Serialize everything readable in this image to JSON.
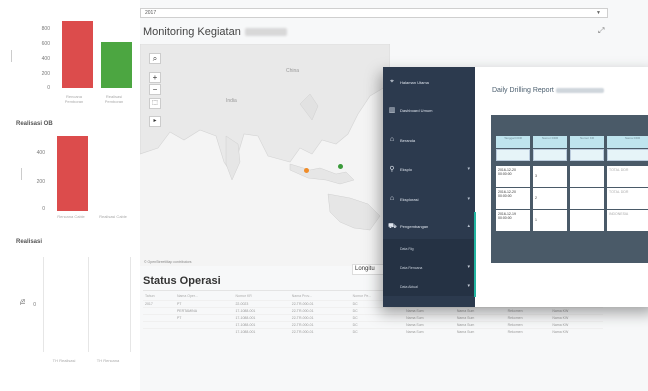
{
  "left_charts": {
    "chart1": {
      "ticks": [
        "800",
        "600",
        "400",
        "200",
        "0"
      ],
      "bars": [
        {
          "label": "Rencana Pemboran",
          "value": 760,
          "color": "#dc4c4c"
        },
        {
          "label": "Realisasi Pemboran",
          "value": 520,
          "color": "#4ca641"
        }
      ]
    },
    "chart2": {
      "title": "Realisasi OB",
      "ticks": [
        "400",
        "200",
        "0"
      ],
      "bars": [
        {
          "label": "Rencana Cable",
          "value": 420,
          "color": "#dc4c4c"
        },
        {
          "label": "Realisasi Cable",
          "value": 0,
          "color": "#4ca641"
        }
      ]
    },
    "chart3": {
      "title": "Realisasi",
      "y_axis": "Ts",
      "ticks": [
        "0"
      ],
      "x_labels": [
        "TH Realisasi",
        "TH Rencana"
      ]
    }
  },
  "dashboard": {
    "year_select": "2017",
    "monitor_title": "Monitoring Kegiatan",
    "map": {
      "labels": [
        "China",
        "India"
      ],
      "attribution": "© OpenStreetMap contributors",
      "zoom_in": "+",
      "zoom_out": "−",
      "tooltip": "Longitu"
    },
    "status_title": "Status Operasi",
    "status_headers": [
      "Tahun",
      "Nama Oper...",
      "Nomor KR",
      "Nama Prov...",
      "Nomor Pe...",
      "Nama Sum",
      "Nama Sum",
      "Rekomen",
      "Kesimpulan"
    ],
    "status_rows": [
      [
        "2017",
        "PT",
        "22-0023",
        "22-TR-000-01",
        "DC",
        "Nama Sum",
        "Nama Sum",
        "Rekomen",
        "Nama KW"
      ],
      [
        "",
        "PERTAMINA",
        "17-1088-001",
        "22-TR-000-01",
        "DC",
        "Nama Sum",
        "Nama Sum",
        "Rekomen",
        "Nama KW"
      ],
      [
        "",
        "PT",
        "17-1088-001",
        "22-TR-000-01",
        "DC",
        "Nama Sum",
        "Nama Sum",
        "Rekomen",
        "Nama KW"
      ],
      [
        "",
        "",
        "17-1088-001",
        "22-TR-000-01",
        "DC",
        "Nama Sum",
        "Nama Sum",
        "Rekomen",
        "Nama KW"
      ],
      [
        "",
        "",
        "17-1088-001",
        "22-TR-000-01",
        "DC",
        "Nama Sum",
        "Nama Sum",
        "Rekomen",
        "Nama KW"
      ]
    ]
  },
  "overlay": {
    "sidebar": [
      {
        "icon": "map-marker-icon",
        "glyph": "⌖",
        "label": "Halaman Utama"
      },
      {
        "icon": "chart-icon",
        "glyph": "▥",
        "label": "Dashboard Umum"
      },
      {
        "icon": "bank-icon",
        "glyph": "⌂",
        "label": "Beranda"
      },
      {
        "icon": "drill-icon",
        "glyph": "⚲",
        "label": "Eksplo"
      },
      {
        "icon": "home-icon",
        "glyph": "⌂",
        "label": "Eksplorasi"
      },
      {
        "icon": "ship-icon",
        "glyph": "⛟",
        "label": "Pengembangan"
      }
    ],
    "submenu": [
      "Data Rig",
      "Data Rencana",
      "Data Aktual"
    ],
    "report_title": "Daily Drilling Report",
    "table_headers": [
      "Tanggal DDR",
      "Nomor DDR",
      "Nomor KR",
      "Nama DDR"
    ],
    "table_rows": [
      {
        "date": "2016-12-20",
        "time": "00:00:00",
        "num": "3",
        "info": "TOTAL DDR"
      },
      {
        "date": "2016-12-20",
        "time": "00:00:00",
        "num": "2",
        "info": "TOTAL DDR"
      },
      {
        "date": "2016-12-19",
        "time": "00:00:00",
        "num": "1",
        "info": "INDONESIA"
      }
    ]
  }
}
